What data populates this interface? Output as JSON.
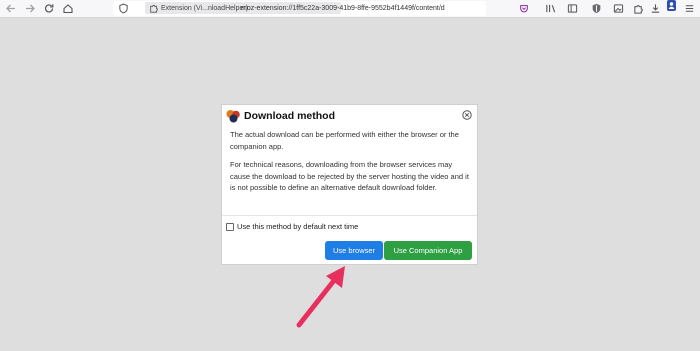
{
  "browser": {
    "identity_label": "Extension (Vi...nloadHelper)",
    "url": "moz-extension://1ff5c22a-3009-41b9-8ffe-9552b4f1449f/content/d"
  },
  "dialog": {
    "title": "Download method",
    "paragraphs": [
      "The actual download can be performed with either the browser or the companion app.",
      "For technical reasons, downloading from the browser services may cause the download to be rejected by the server hosting the video and it is not possible to define an alternative default download folder."
    ],
    "default_checkbox": {
      "label": "Use this method by default next time",
      "checked": false
    },
    "buttons": {
      "browser": "Use browser",
      "companion": "Use Companion App"
    }
  },
  "colors": {
    "browser_button": "#1f7ee6",
    "companion_button": "#2ea043",
    "annotation_arrow": "#e8305e"
  }
}
